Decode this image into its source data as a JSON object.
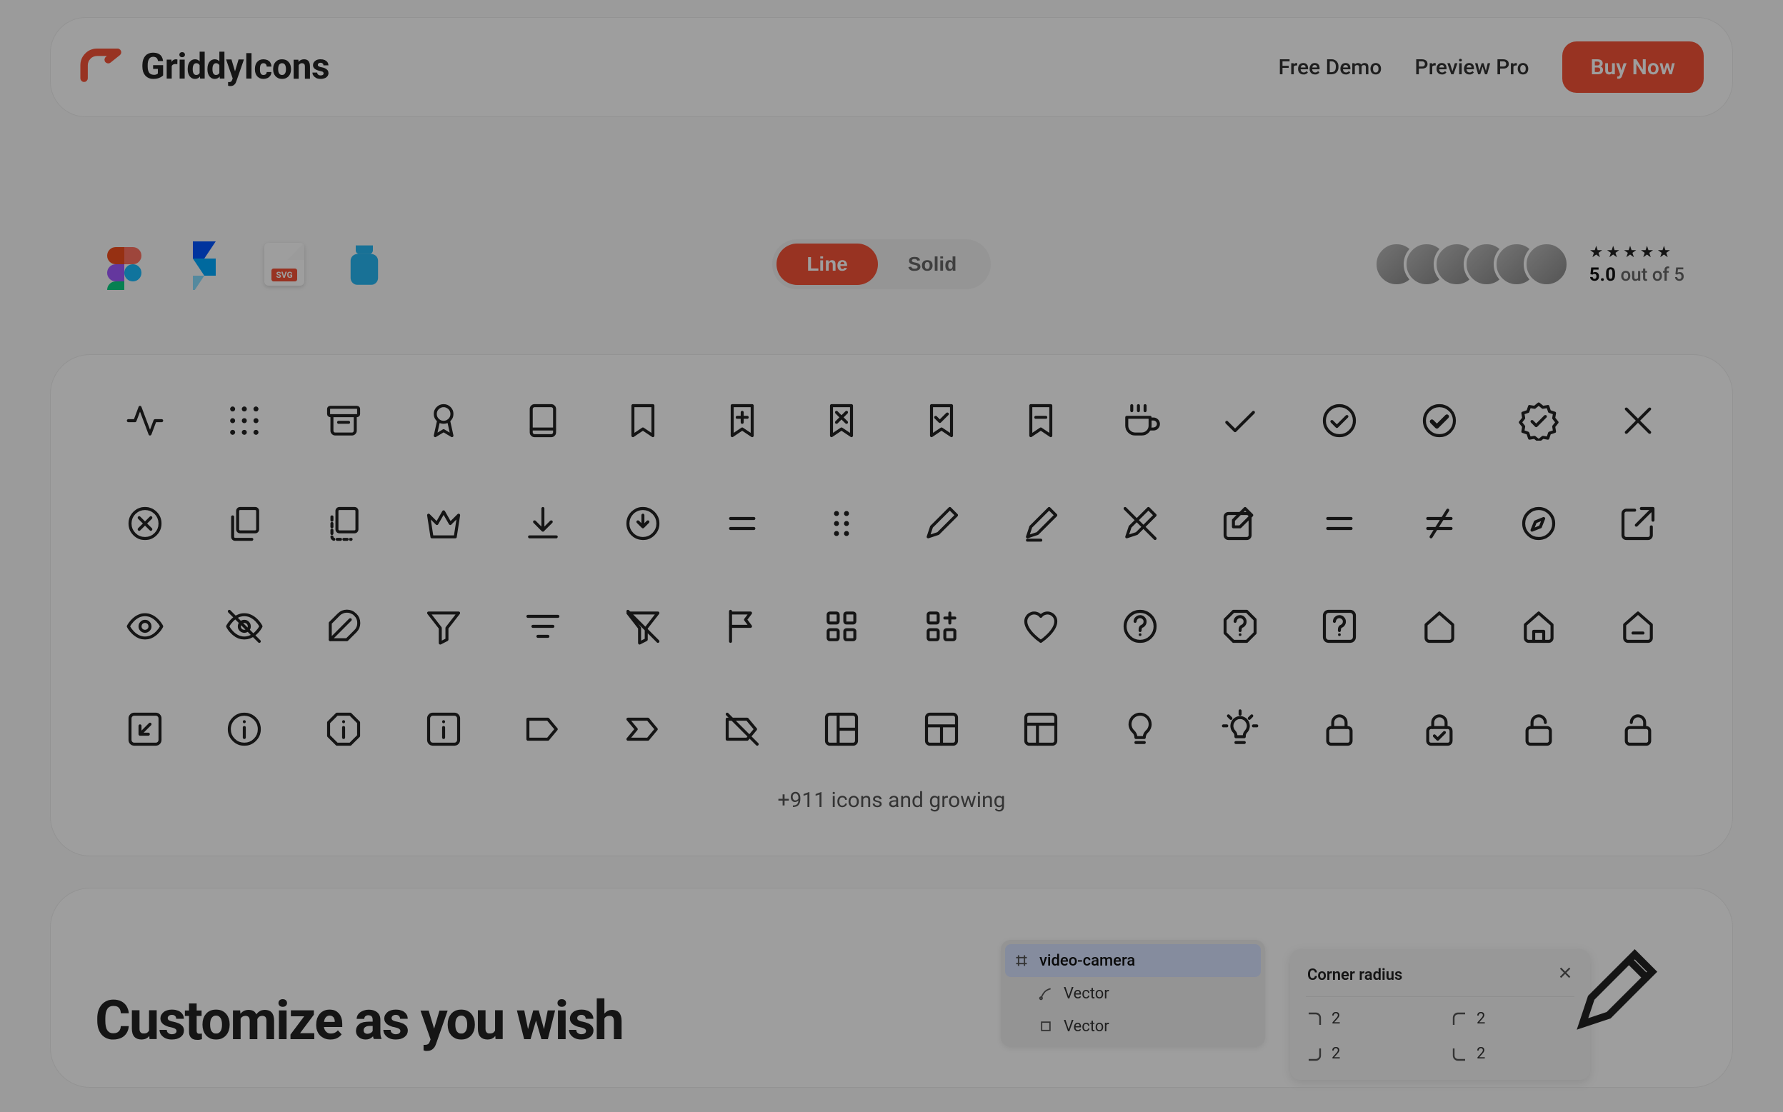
{
  "brand": {
    "name": "GriddyIcons"
  },
  "nav": {
    "free_demo": "Free Demo",
    "preview_pro": "Preview Pro",
    "buy_now": "Buy Now"
  },
  "badges": {
    "svg_label": "SVG"
  },
  "style_toggle": {
    "line": "Line",
    "solid": "Solid",
    "active": "line"
  },
  "rating": {
    "score": "5.0",
    "suffix": " out of 5",
    "star_display": "★★★★★"
  },
  "icons_growing": "+911 icons and growing",
  "lower": {
    "title": "Customize as you wish"
  },
  "layers": {
    "group_icon_name": "frame-icon",
    "group": "video-camera",
    "row2_icon_name": "vector-anchor-icon",
    "row2": "Vector",
    "row3_icon_name": "vector-square-icon",
    "row3": "Vector"
  },
  "radius": {
    "title": "Corner radius",
    "tl": "2",
    "tr": "2",
    "bl": "2",
    "br": "2"
  },
  "icon_names": [
    [
      "activity",
      "grid-dots",
      "archive",
      "award",
      "book",
      "bookmark",
      "bookmark-plus",
      "bookmark-x",
      "bookmark-check",
      "bookmark-minus",
      "coffee",
      "check",
      "check-circle",
      "check-badge",
      "verified",
      "x"
    ],
    [
      "x-circle",
      "copy",
      "copy-dashed",
      "crown",
      "download",
      "download-circle",
      "drag-h",
      "drag-dots",
      "edit",
      "pencil",
      "pen-off",
      "edit-square",
      "equals",
      "not-equal",
      "compass",
      "external-link"
    ],
    [
      "eye",
      "eye-off",
      "feather",
      "filter",
      "filter-lines",
      "filter-off",
      "flag",
      "grid",
      "apps",
      "heart",
      "help-circle",
      "help-octagon",
      "help-square",
      "home",
      "home-alt",
      "home-minus"
    ],
    [
      "box-arrow-in",
      "info-circle",
      "info-octagon",
      "info-square",
      "label",
      "tag",
      "tag-off",
      "layout-left",
      "layout-top",
      "layout-window",
      "lightbulb",
      "idea",
      "lock",
      "lock-check",
      "unlock",
      "unlock-alt"
    ]
  ]
}
